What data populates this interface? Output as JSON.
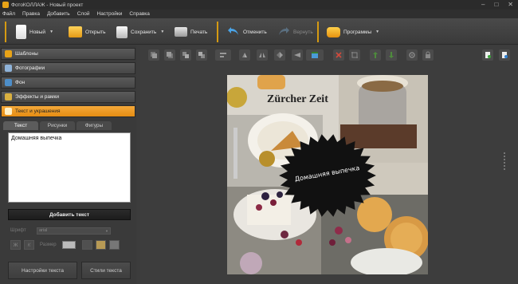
{
  "window": {
    "title": "ФотоКОЛЛАЖ - Новый проект"
  },
  "menu": [
    "Файл",
    "Правка",
    "Добавить",
    "Слой",
    "Настройки",
    "Справка"
  ],
  "toolbar": {
    "new_label": "Новый",
    "open_label": "Открыть",
    "save_label": "Сохранить",
    "print_label": "Печать",
    "undo_label": "Отменить",
    "redo_label": "Вернуть",
    "programs_label": "Программы"
  },
  "sidebar": {
    "items": [
      {
        "label": "Шаблоны",
        "icon": "star-icon"
      },
      {
        "label": "Фотографии",
        "icon": "photo-icon"
      },
      {
        "label": "Фон",
        "icon": "background-icon"
      },
      {
        "label": "Эффекты и рамки",
        "icon": "effects-icon"
      },
      {
        "label": "Текст и украшения",
        "icon": "text-icon"
      }
    ],
    "tabs": [
      "Текст",
      "Рисунки",
      "Фигуры"
    ],
    "text_value": "Домашняя выпечка",
    "add_text_label": "Добавить текст",
    "font_label": "Шрифт",
    "font_value": "arial",
    "size_label": "Размер",
    "settings_label": "Настройки текста",
    "styles_label": "Стили текста"
  },
  "canvas": {
    "caption": "Домашняя выпечка",
    "newspaper_text": "Zürcher Zeit"
  },
  "colors": {
    "accent": "#e8970f",
    "toolbar_separator": "#d59a12",
    "panel_bg": "#3a3a3a"
  }
}
